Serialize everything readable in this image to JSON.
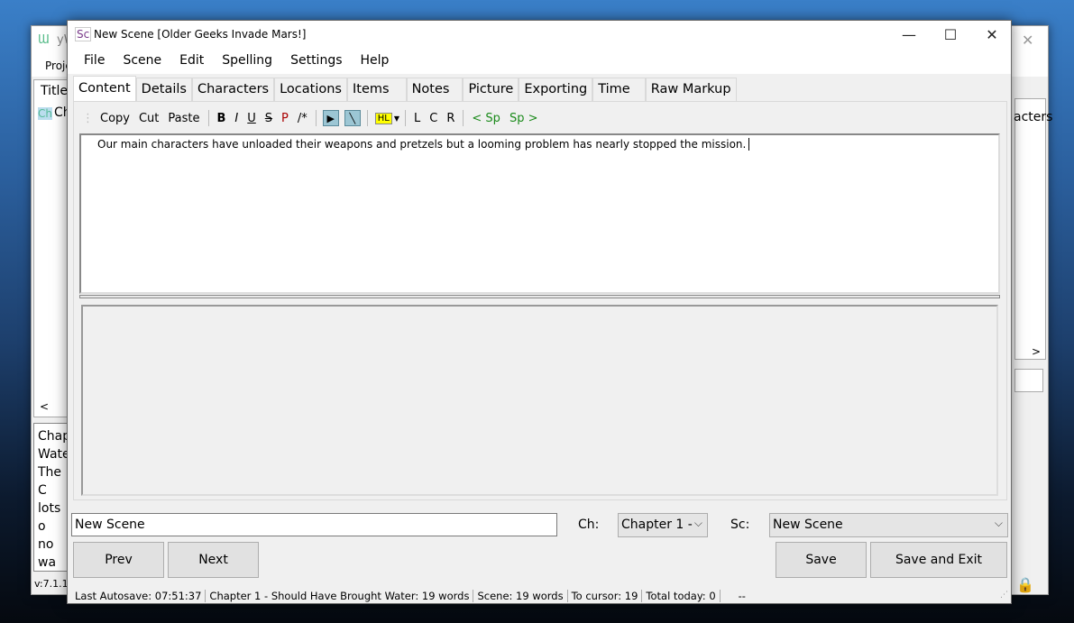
{
  "back_window": {
    "title_fragment": "yW",
    "menu_fragment": "Proje",
    "list_header": "Title",
    "list_item": "Ch",
    "list_item_icon": "Ch",
    "right_header_fragment": "acters",
    "notes_lines": [
      "Chap",
      "Wate",
      "The C",
      "lots o",
      "no wa"
    ],
    "version_fragment": "v:7.1.1."
  },
  "window": {
    "title": "New Scene [Older Geeks Invade Mars!]",
    "app_icon": "Sc"
  },
  "menu": [
    "File",
    "Scene",
    "Edit",
    "Spelling",
    "Settings",
    "Help"
  ],
  "tabs": [
    "Content",
    "Details",
    "Characters",
    "Locations",
    "Items",
    "Notes",
    "Picture",
    "Exporting",
    "Time",
    "Raw Markup"
  ],
  "toolbar": {
    "copy": "Copy",
    "cut": "Cut",
    "paste": "Paste",
    "bold": "B",
    "italic": "I",
    "underline": "U",
    "strike": "S",
    "p": "P",
    "comment": "/*",
    "hl": "HL",
    "left": "L",
    "center": "C",
    "right": "R",
    "prev_sp": "< Sp",
    "next_sp": "Sp >"
  },
  "content_text": "Our main characters have unloaded their weapons and pretzels but a looming problem has nearly stopped the mission.",
  "scene_name": "New Scene",
  "ch_label": "Ch:",
  "ch_value": "Chapter 1 -",
  "sc_label": "Sc:",
  "sc_value": "New Scene",
  "buttons": {
    "prev": "Prev",
    "next": "Next",
    "save": "Save",
    "save_exit": "Save and Exit"
  },
  "status": [
    "Last Autosave: 07:51:37",
    "Chapter 1 - Should Have Brought Water: 19 words",
    "Scene: 19 words",
    "To cursor: 19",
    "Total today: 0",
    "",
    "--"
  ]
}
